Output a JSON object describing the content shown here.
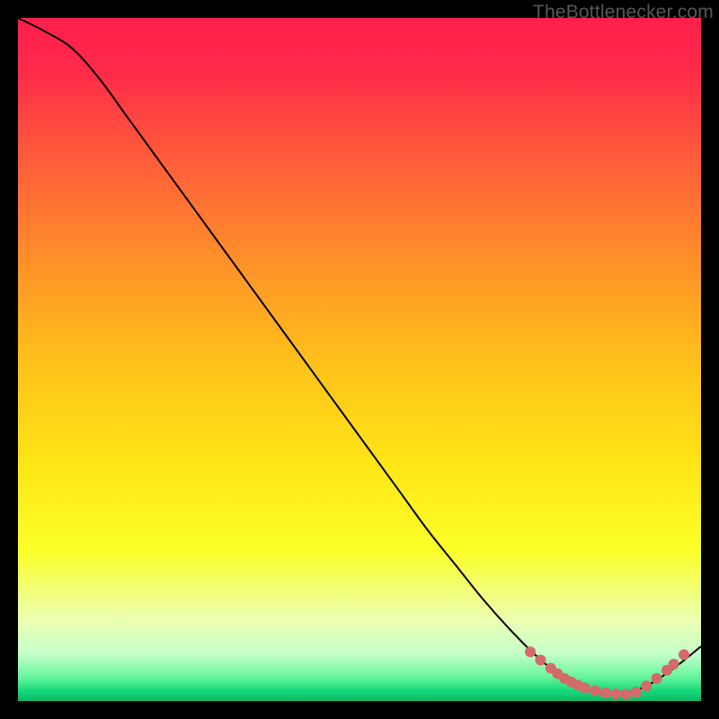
{
  "watermark": "TheBottlenecker.com",
  "chart_data": {
    "type": "line",
    "title": "",
    "xlabel": "",
    "ylabel": "",
    "xlim": [
      0,
      100
    ],
    "ylim": [
      0,
      100
    ],
    "x": [
      0,
      4,
      8,
      12,
      16,
      20,
      24,
      28,
      32,
      36,
      40,
      44,
      48,
      52,
      56,
      60,
      64,
      68,
      72,
      76,
      80,
      84,
      88,
      92,
      96,
      100
    ],
    "y": [
      100,
      98,
      95.5,
      91,
      85.5,
      80,
      74.5,
      69,
      63.5,
      58,
      52.5,
      47,
      41.5,
      36,
      30.5,
      25,
      20,
      15,
      10.5,
      6.5,
      3.3,
      1.5,
      1,
      2.2,
      4.8,
      8
    ],
    "valley_markers_x": [
      75,
      76.5,
      78,
      79,
      80,
      81,
      82,
      83,
      84.5,
      86,
      87.5,
      89,
      90.5,
      92,
      93.5,
      95,
      96,
      97.5
    ],
    "valley_markers_y": [
      7.2,
      6,
      4.8,
      4,
      3.3,
      2.8,
      2.3,
      1.9,
      1.5,
      1.2,
      1.05,
      1,
      1.3,
      2.2,
      3.3,
      4.5,
      5.4,
      6.8
    ],
    "gradient_stops": [
      {
        "pos": 0.0,
        "color": "#ff1f4c"
      },
      {
        "pos": 0.08,
        "color": "#ff2b49"
      },
      {
        "pos": 0.2,
        "color": "#ff5a3b"
      },
      {
        "pos": 0.35,
        "color": "#ff8e2a"
      },
      {
        "pos": 0.5,
        "color": "#ffc01a"
      },
      {
        "pos": 0.65,
        "color": "#ffe516"
      },
      {
        "pos": 0.78,
        "color": "#fbff28"
      },
      {
        "pos": 0.88,
        "color": "#ecffb0"
      },
      {
        "pos": 0.93,
        "color": "#c6ffca"
      },
      {
        "pos": 0.965,
        "color": "#67f59c"
      },
      {
        "pos": 0.985,
        "color": "#17d87a"
      },
      {
        "pos": 1.0,
        "color": "#0fb867"
      }
    ],
    "marker_color": "#d46a6a",
    "line_color": "#000000"
  }
}
